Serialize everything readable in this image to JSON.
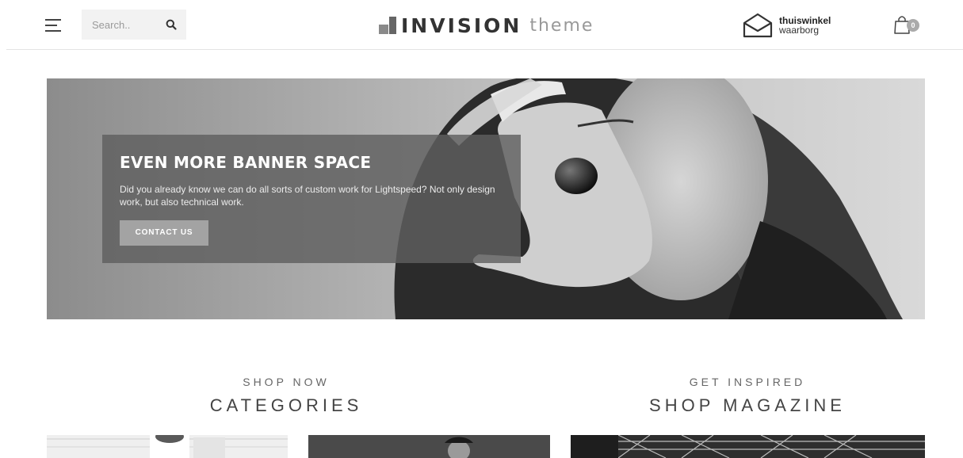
{
  "header": {
    "menu_icon": "hamburger-icon",
    "search": {
      "placeholder": "Search..",
      "icon": "search-icon"
    },
    "logo": {
      "strong": "INVISION",
      "light": "theme"
    },
    "trust_badge": {
      "line1": "thuiswinkel",
      "line2": "waarborg",
      "icon": "envelope-house-icon"
    },
    "cart": {
      "count": "0",
      "icon": "shopping-bag-icon"
    }
  },
  "banner": {
    "title": "EVEN MORE BANNER SPACE",
    "text": "Did you already know we can do all sorts of custom work for Lightspeed? Not only design work, but also technical work.",
    "cta_label": "CONTACT US"
  },
  "sections": {
    "categories": {
      "kicker": "SHOP NOW",
      "title": "CATEGORIES"
    },
    "magazine": {
      "kicker": "GET INSPIRED",
      "title": "SHOP MAGAZINE"
    }
  },
  "colors": {
    "accent": "#a3a3a3",
    "header_line": "#e3e3e3",
    "banner_box": "#5f5f5f"
  }
}
